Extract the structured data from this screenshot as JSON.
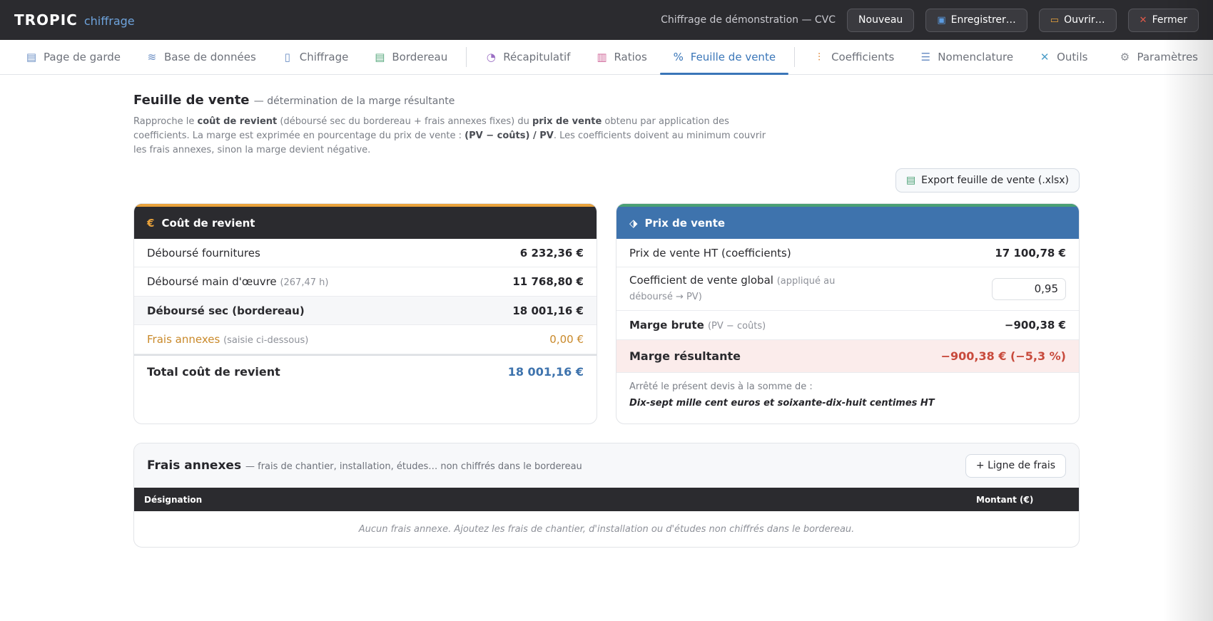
{
  "app": {
    "logo_main": "TROPIC",
    "logo_sub": "chiffrage",
    "doc_title": "Chiffrage de démonstration — CVC"
  },
  "toolbar": {
    "new_label": "Nouveau",
    "save_label": "Enregistrer…",
    "open_label": "Ouvrir…",
    "close_label": "Fermer"
  },
  "tabs": [
    {
      "label": "Page de garde",
      "icon": "document-icon"
    },
    {
      "label": "Base de données",
      "icon": "database-icon"
    },
    {
      "label": "Chiffrage",
      "icon": "clipboard-icon"
    },
    {
      "label": "Bordereau",
      "icon": "file-icon"
    },
    {
      "label": "Récapitulatif",
      "icon": "pie-chart-icon"
    },
    {
      "label": "Ratios",
      "icon": "ratio-icon"
    },
    {
      "label": "Feuille de vente",
      "icon": "percent-icon",
      "active": true
    },
    {
      "label": "Coefficients",
      "icon": "sliders-icon"
    },
    {
      "label": "Nomenclature",
      "icon": "list-icon"
    },
    {
      "label": "Outils",
      "icon": "tools-icon"
    },
    {
      "label": "Paramètres",
      "icon": "gear-icon"
    }
  ],
  "page": {
    "title": "Feuille de vente",
    "subtitle": "— détermination de la marge résultante",
    "desc": {
      "p1": "Rapproche le ",
      "b1": "coût de revient",
      "p2": " (déboursé sec du bordereau + frais annexes fixes) du ",
      "b2": "prix de vente",
      "p3": " obtenu par application des coefficients. La marge est exprimée en pourcentage du prix de vente : ",
      "b3": "(PV − coûts) / PV",
      "p4": ". Les coefficients doivent au minimum couvrir les frais annexes, sinon la marge devient négative."
    },
    "export_label": "Export feuille de vente (.xlsx)"
  },
  "cost": {
    "title": "Coût de revient",
    "fournitures_label": "Déboursé fournitures",
    "fournitures_value": "6 232,36 €",
    "mo_label": "Déboursé main d'œuvre",
    "mo_hours": "(267,47 h)",
    "mo_value": "11 768,80 €",
    "sec_label": "Déboursé sec (bordereau)",
    "sec_value": "18 001,16 €",
    "frais_label": "Frais annexes",
    "frais_note": "(saisie ci-dessous)",
    "frais_value": "0,00 €",
    "total_label": "Total coût de revient",
    "total_value": "18 001,16 €"
  },
  "sale": {
    "title": "Prix de vente",
    "pv_label": "Prix de vente HT (coefficients)",
    "pv_value": "17 100,78 €",
    "coef_label": "Coefficient de vente global",
    "coef_note": "(appliqué au déboursé → PV)",
    "coef_value": "0,95",
    "marge_brute_label": "Marge brute",
    "marge_brute_note": "(PV − coûts)",
    "marge_brute_value": "−900,38 €",
    "marge_res_label": "Marge résultante",
    "marge_res_value": "−900,38 € (−5,3 %)",
    "words_intro": "Arrêté le présent devis à la somme de :",
    "words_amount": "Dix-sept mille cent euros et soixante-dix-huit centimes HT"
  },
  "frais": {
    "title": "Frais annexes",
    "subtitle": "— frais de chantier, installation, études… non chiffrés dans le bordereau",
    "add_label": "+ Ligne de frais",
    "col_designation": "Désignation",
    "col_montant": "Montant (€)",
    "empty": "Aucun frais annexe. Ajoutez les frais de chantier, d'installation ou d'études non chiffrés dans le bordereau."
  },
  "colors": {
    "accent": "#3a76b8",
    "dark": "#2b2b2f",
    "orange": "#e9a23b",
    "negative": "#c84a3c"
  }
}
